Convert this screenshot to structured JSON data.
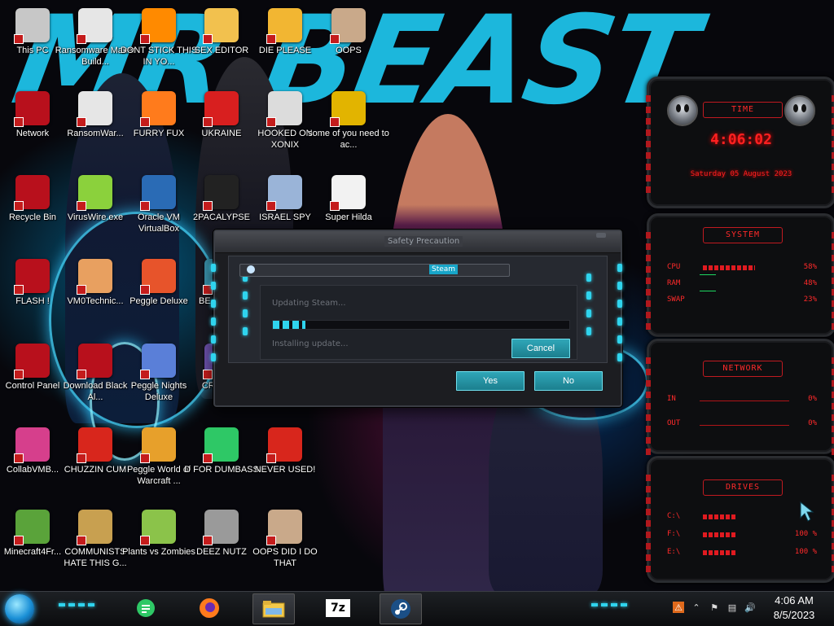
{
  "wallpaper": {
    "title_text": "MR BEAST"
  },
  "desktop_icons": [
    {
      "label": "This PC",
      "icon": "computer-icon",
      "color": "#c7c7c7"
    },
    {
      "label": "Ransomware Maker Build...",
      "icon": "document-icon",
      "color": "#e6e6e6"
    },
    {
      "label": "DONT STICK THIS IN YO...",
      "icon": "vlc-cone-icon",
      "color": "#ff8a00"
    },
    {
      "label": "SEX EDITOR",
      "icon": "hxd-icon",
      "color": "#f2c14e"
    },
    {
      "label": "DIE PLEASE",
      "icon": "de-icon",
      "color": "#f2b632"
    },
    {
      "label": "OOPS",
      "icon": "portrait-icon",
      "color": "#c9a98a"
    },
    {
      "label": "Network",
      "icon": "network-globe-icon",
      "color": "#b8101c"
    },
    {
      "label": "RansomWar...",
      "icon": "skull-icon",
      "color": "#e6e6e6"
    },
    {
      "label": "FURRY FUX",
      "icon": "firefox-icon",
      "color": "#ff7b1c"
    },
    {
      "label": "UKRAINE",
      "icon": "radiation-icon",
      "color": "#d81f1f"
    },
    {
      "label": "HOOKED ON XONIX",
      "icon": "xonix-icon",
      "color": "#dcdcdc"
    },
    {
      "label": "some of you need to ac...",
      "icon": "beaver-icon",
      "color": "#e2b400"
    },
    {
      "label": "Recycle Bin",
      "icon": "recycle-bin-icon",
      "color": "#b8101c"
    },
    {
      "label": "VirusWire.exe",
      "icon": "lime-icon",
      "color": "#8bd13c"
    },
    {
      "label": "Oracle VM VirtualBox",
      "icon": "virtualbox-icon",
      "color": "#2a6bb5"
    },
    {
      "label": "2PACALYPSE",
      "icon": "terminal-icon",
      "color": "#222"
    },
    {
      "label": "ISRAEL SPY",
      "icon": "spy-icon",
      "color": "#9ab4d8"
    },
    {
      "label": "Super Hilda",
      "icon": "hilda-icon",
      "color": "#f2f2f2"
    },
    {
      "label": "FLASH !",
      "icon": "flash-icon",
      "color": "#b8101c"
    },
    {
      "label": "VM0Technic...",
      "icon": "doctor-icon",
      "color": "#e8a060"
    },
    {
      "label": "Peggle Deluxe",
      "icon": "peggle-icon",
      "color": "#e7542b"
    },
    {
      "label": "BE JU THE",
      "icon": "partial-icon",
      "color": "#3a8fa8"
    },
    {
      "label": "Control Panel",
      "icon": "control-panel-icon",
      "color": "#b8101c"
    },
    {
      "label": "Download Black Al...",
      "icon": "alien-orb-icon",
      "color": "#b8101c"
    },
    {
      "label": "Peggle Nights Deluxe",
      "icon": "peggle-nights-icon",
      "color": "#5a7fd8"
    },
    {
      "label": "CRE CHL",
      "icon": "partial-icon",
      "color": "#6a4fa8"
    },
    {
      "label": "CollabVMB...",
      "icon": "monitor-icon",
      "color": "#d63f8c"
    },
    {
      "label": "CHUZZIN CUM",
      "icon": "chuzzle-icon",
      "color": "#d8261c"
    },
    {
      "label": "Peggle World of Warcraft ...",
      "icon": "peggle-wow-icon",
      "color": "#e7a02b"
    },
    {
      "label": "D FOR DUMBASS",
      "icon": "chat-icon",
      "color": "#2ec866"
    },
    {
      "label": "NEVER USED!",
      "icon": "devcpp-icon",
      "color": "#d8261c"
    },
    {
      "label": "Minecraft4Fr...",
      "icon": "grass-block-icon",
      "color": "#5aa33a"
    },
    {
      "label": "COMMUNISTS HATE THIS G...",
      "icon": "money-bag-icon",
      "color": "#c8a050"
    },
    {
      "label": "Plants vs Zombies",
      "icon": "pvz-icon",
      "color": "#8bc34a"
    },
    {
      "label": "DEEZ NUTZ",
      "icon": "windows-stack-icon",
      "color": "#9a9a9a"
    },
    {
      "label": "OOPS DID I DO THAT",
      "icon": "portrait-icon",
      "color": "#c9a98a"
    }
  ],
  "dialog": {
    "window_title": "Safety Precaution",
    "tab_label": "Steam",
    "status": "Updating Steam...",
    "substatus": "Installing update...",
    "progress_fraction": 0.11,
    "cancel_label": "Cancel",
    "yes_label": "Yes",
    "no_label": "No"
  },
  "gadgets": {
    "clock": {
      "header": "TIME",
      "time": "4:06:02",
      "date": "Saturday 05 August 2023"
    },
    "system": {
      "header": "SYSTEM",
      "rows": [
        {
          "key": "CPU",
          "value": "58%",
          "fraction": 0.58
        },
        {
          "key": "RAM",
          "value": "48%",
          "fraction": 0.48
        },
        {
          "key": "SWAP",
          "value": "23%",
          "fraction": 0.23
        }
      ]
    },
    "network": {
      "header": "NETWORK",
      "rows": [
        {
          "key": "IN",
          "value": "0%"
        },
        {
          "key": "OUT",
          "value": "0%"
        }
      ]
    },
    "drives": {
      "header": "DRIVES",
      "rows": [
        {
          "key": "C:\\",
          "value": ""
        },
        {
          "key": "F:\\",
          "value": "100 %"
        },
        {
          "key": "E:\\",
          "value": "100 %"
        }
      ]
    }
  },
  "taskbar": {
    "apps": [
      {
        "name": "chat-app-icon",
        "color": "#2ec866"
      },
      {
        "name": "firefox-icon",
        "color": "#ff7b1c"
      },
      {
        "name": "file-explorer-icon",
        "color": "#f3c94a"
      },
      {
        "name": "7zip-icon",
        "label": "7z",
        "color": "#ffffff"
      },
      {
        "name": "steam-icon",
        "color": "#1b6aa8"
      }
    ],
    "clock_time": "4:06 AM",
    "clock_date": "8/5/2023"
  }
}
